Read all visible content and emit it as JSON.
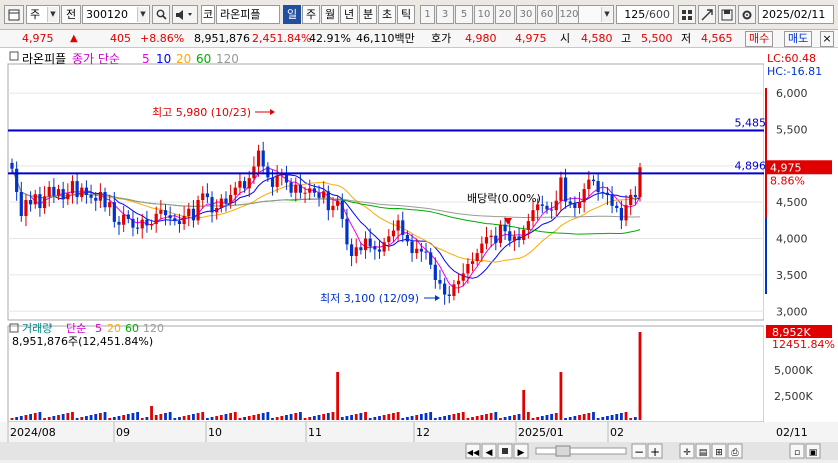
{
  "toolbar": {
    "period_label": "주",
    "prev_label": "전",
    "stock_code": "300120",
    "market_badge": "코",
    "stock_name": "라온피플",
    "tabs": [
      "일",
      "주",
      "월",
      "년",
      "분",
      "초",
      "틱"
    ],
    "selected_tab": "일",
    "numbers": [
      "1",
      "3",
      "5",
      "10",
      "20",
      "30",
      "60",
      "120"
    ],
    "count_label": "125",
    "count_total": "/600",
    "date_value": "2025/02/11"
  },
  "quote": {
    "price": "4,975",
    "change_arrow": "▲",
    "change": "405",
    "change_rate": "+8.86%",
    "volume": "8,951,876",
    "volume_rate": "2,451.84%",
    "turnover": "42.91%",
    "amount": "46,110백만",
    "ask_label": "호가",
    "ask_value": "4,980",
    "bid_value": "4,975",
    "open_label": "시",
    "open_value": "4,580",
    "high_label": "고",
    "high_value": "5,500",
    "low_label": "저",
    "low_value": "4,565",
    "buy_label": "매수",
    "sell_label": "매도"
  },
  "price_panel": {
    "legend_name": "라온피플",
    "legend_close": "종가 단순",
    "ma_periods": [
      "5",
      "10",
      "20",
      "60",
      "120"
    ],
    "ma_colors": [
      "#ee00ee",
      "#0000ff",
      "#ffaa00",
      "#00aa00",
      "#999999"
    ],
    "lc_label": "LC:60.48",
    "hc_label": "HC:-16.81",
    "y_ticks": [
      "6,000",
      "5,500",
      "5,000",
      "4,500",
      "4,000",
      "3,500",
      "3,000"
    ],
    "high_annotation": "최고 5,980 (10/23)",
    "low_annotation": "최저 3,100 (12/09)",
    "dividend_annotation": "배당락(0.00%)",
    "line_upper_value": "5,485",
    "line_lower_value": "4,896",
    "current_price_tag": "4,975",
    "current_rate_tag": "8.86%"
  },
  "volume_panel": {
    "legend_name": "거래량",
    "legend_ma": "단순",
    "ma_periods": [
      "5",
      "20",
      "60",
      "120"
    ],
    "volume_text": "8,951,876주(12,451.84%)",
    "y_ticks": [
      "5,000K",
      "2,500K"
    ],
    "volume_tag": "8,952K",
    "volume_rate_tag": "12451.84%"
  },
  "x_axis": {
    "labels": [
      "2024/08",
      "09",
      "10",
      "11",
      "12",
      "2025/01",
      "02"
    ],
    "right_label": "02/11"
  },
  "colors": {
    "up": "#e00000",
    "down": "#0033cc",
    "accent": "#1f4f9e"
  },
  "chart_data": {
    "type": "candlestick",
    "y_range": [
      3000,
      6000
    ],
    "horizontal_lines": [
      5485,
      4896
    ],
    "closes": [
      4960,
      4640,
      4310,
      4530,
      4470,
      4610,
      4420,
      4580,
      4710,
      4590,
      4680,
      4540,
      4620,
      4790,
      4570,
      4700,
      4600,
      4560,
      4520,
      4640,
      4430,
      4500,
      4230,
      4190,
      4330,
      4270,
      4150,
      4140,
      4260,
      4180,
      4200,
      4340,
      4390,
      4320,
      4280,
      4240,
      4200,
      4310,
      4410,
      4250,
      4530,
      4620,
      4570,
      4360,
      4420,
      4550,
      4490,
      4600,
      4700,
      4790,
      4690,
      4830,
      4990,
      5210,
      4990,
      4840,
      4710,
      4870,
      4880,
      4770,
      4630,
      4740,
      4630,
      4630,
      4690,
      4630,
      4560,
      4650,
      4390,
      4450,
      4520,
      4270,
      3920,
      3760,
      3880,
      3840,
      4000,
      3890,
      3850,
      3820,
      3950,
      4030,
      4110,
      4250,
      4050,
      3960,
      3800,
      3860,
      3820,
      3810,
      3640,
      3430,
      3380,
      3230,
      3210,
      3370,
      3420,
      3520,
      3650,
      3690,
      3800,
      3930,
      4020,
      4040,
      3940,
      4190,
      4100,
      3970,
      4030,
      3980,
      4120,
      4240,
      4390,
      4470,
      4450,
      4400,
      4390,
      4520,
      4840,
      4510,
      4480,
      4420,
      4500,
      4680,
      4810,
      4790,
      4640,
      4630,
      4600,
      4450,
      4420,
      4250,
      4460,
      4600,
      4570,
      4980
    ]
  }
}
